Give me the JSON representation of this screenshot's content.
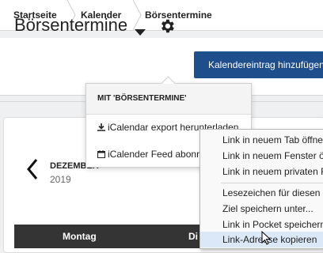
{
  "breadcrumb": [
    "Startseite",
    "Kalender",
    "Börsentermine"
  ],
  "header": {
    "title": "Börsentermine",
    "add_button": "Kalendereintrag hinzufügen"
  },
  "dropdown": {
    "heading": "MIT 'BÖRSENTERMINE'",
    "items": [
      "iCalendar export herunterladen",
      "iCalender Feed abonnieren"
    ]
  },
  "calendar": {
    "month": "DEZEMBER",
    "year": "2019",
    "day_headers": [
      "Montag",
      "Di"
    ]
  },
  "context_menu": {
    "items": [
      "Link in neuem Tab öffnen",
      "Link in neuem Fenster öffnen",
      "Link in neuem privaten Fenster öffnen",
      "Lesezeichen für diesen Link hinzufügen",
      "Ziel speichern unter...",
      "Link in Pocket speichern",
      "Link-Adresse kopieren"
    ],
    "highlighted": "Link-Adresse kopieren"
  },
  "colors": {
    "primary": "#1f4e8c",
    "day_header_bg": "#343434",
    "menu_highlight": "#dbe8f7"
  },
  "icons": [
    "chevron-right-icon",
    "caret-down-icon",
    "gear-icon",
    "download-icon",
    "calendar-icon",
    "chevron-left-icon",
    "mouse-cursor-icon"
  ]
}
